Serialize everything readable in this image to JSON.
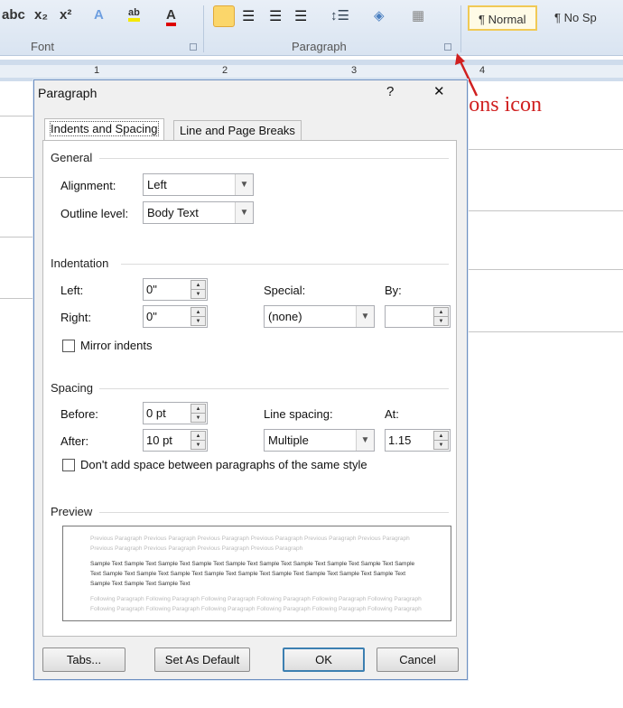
{
  "ribbon": {
    "font_buttons": [
      "abc",
      "x₂",
      "x²",
      "A",
      "ab",
      "A"
    ],
    "font_group": "Font",
    "paragraph_group": "Paragraph",
    "styles": [
      "¶ Normal",
      "¶ No Sp"
    ],
    "ruler_numbers": [
      "1",
      "2",
      "3",
      "4"
    ]
  },
  "annotation": {
    "text": "expanded options icon",
    "color": "#d02020"
  },
  "dialog": {
    "title": "Paragraph",
    "help": "?",
    "close": "✕",
    "tabs": [
      {
        "label": "Indents and Spacing",
        "active": true
      },
      {
        "label": "Line and Page Breaks",
        "active": false
      }
    ],
    "general": {
      "heading": "General",
      "alignment_label": "Alignment:",
      "alignment_value": "Left",
      "outline_label": "Outline level:",
      "outline_value": "Body Text"
    },
    "indentation": {
      "heading": "Indentation",
      "left_label": "Left:",
      "left_value": "0\"",
      "right_label": "Right:",
      "right_value": "0\"",
      "special_label": "Special:",
      "special_value": "(none)",
      "by_label": "By:",
      "by_value": "",
      "mirror_label": "Mirror indents",
      "mirror_checked": false
    },
    "spacing": {
      "heading": "Spacing",
      "before_label": "Before:",
      "before_value": "0 pt",
      "after_label": "After:",
      "after_value": "10 pt",
      "line_label": "Line spacing:",
      "line_value": "Multiple",
      "at_label": "At:",
      "at_value": "1.15",
      "dont_add_label": "Don't add space between paragraphs of the same style",
      "dont_add_checked": false
    },
    "preview": {
      "heading": "Preview",
      "previous": "Previous Paragraph Previous Paragraph Previous Paragraph Previous Paragraph Previous Paragraph Previous Paragraph Previous Paragraph Previous Paragraph Previous Paragraph Previous Paragraph",
      "sample": "Sample Text Sample Text Sample Text Sample Text Sample Text Sample Text Sample Text Sample Text Sample Text Sample Text Sample Text Sample Text Sample Text Sample Text Sample Text Sample Text Sample Text Sample Text Sample Text Sample Text Sample Text Sample Text",
      "following": "Following Paragraph Following Paragraph Following Paragraph Following Paragraph Following Paragraph Following Paragraph Following Paragraph Following Paragraph Following Paragraph Following Paragraph Following Paragraph Following Paragraph"
    },
    "buttons": {
      "tabs": "Tabs...",
      "default": "Set As Default",
      "ok": "OK",
      "cancel": "Cancel"
    }
  }
}
